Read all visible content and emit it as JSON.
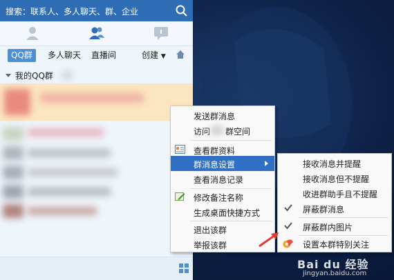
{
  "search": {
    "placeholder": "搜索：联系人、多人聊天、群、企业"
  },
  "icons": {
    "search": "search-icon",
    "contacts": "person-icon",
    "groups": "group-icon",
    "messages": "chat-icon",
    "home": "home-icon",
    "apps": "grid-icon"
  },
  "sub_tabs": {
    "qq_group": "QQ群",
    "multi_chat": "多人聊天",
    "live": "直播间",
    "create": "创建"
  },
  "group_header": "我的QQ群",
  "context_menu": {
    "send_msg": "发送群消息",
    "visit_space": "访问",
    "visit_space_suffix": "群空间",
    "view_info": "查看群资料",
    "msg_settings": "群消息设置",
    "view_history": "查看消息记录",
    "edit_note": "修改备注名称",
    "create_shortcut": "生成桌面快捷方式",
    "exit_group": "退出该群",
    "report_group": "举报该群"
  },
  "submenu": {
    "receive_notify": "接收消息并提醒",
    "receive_silent": "接收消息但不提醒",
    "to_assistant": "收进群助手且不提醒",
    "block_msgs": "屏蔽群消息",
    "block_images": "屏蔽群内图片",
    "special_care": "设置本群特别关注"
  },
  "checked": {
    "block_msgs": true,
    "block_images": true
  },
  "watermark": {
    "brand": "Bai du 经验",
    "site": "jingyan.baidu.com"
  },
  "colors": {
    "accent": "#2f6db5",
    "menu_highlight": "#2f6fc4",
    "selected_row": "#fbe6bf"
  }
}
